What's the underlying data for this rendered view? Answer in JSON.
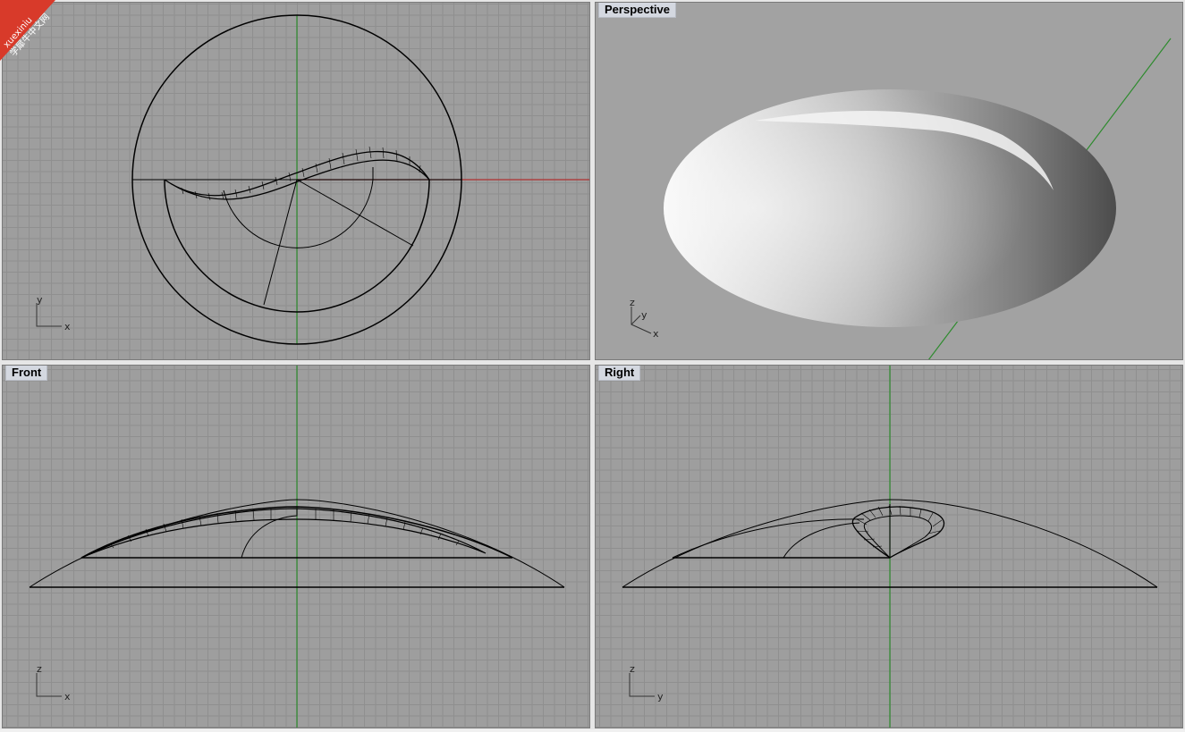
{
  "viewports": {
    "top": {
      "title": ""
    },
    "perspective": {
      "title": "Perspective",
      "axes": {
        "x": "x",
        "y": "y",
        "z": "z"
      }
    },
    "front": {
      "title": "Front",
      "axes": {
        "h": "x",
        "v": "z"
      }
    },
    "right": {
      "title": "Right",
      "axes": {
        "h": "y",
        "v": "z"
      }
    }
  },
  "top_axes": {
    "h": "x",
    "v": "y"
  },
  "watermark": {
    "latin": "xuexiniu",
    "cn": "学犀牛中文网",
    "color": "#d83a2a"
  },
  "colors": {
    "x_axis": "#b03030",
    "y_axis": "#2e8b2e",
    "grid": "#8f8f8f",
    "background": "#9e9e9e",
    "curve": "#000000"
  }
}
